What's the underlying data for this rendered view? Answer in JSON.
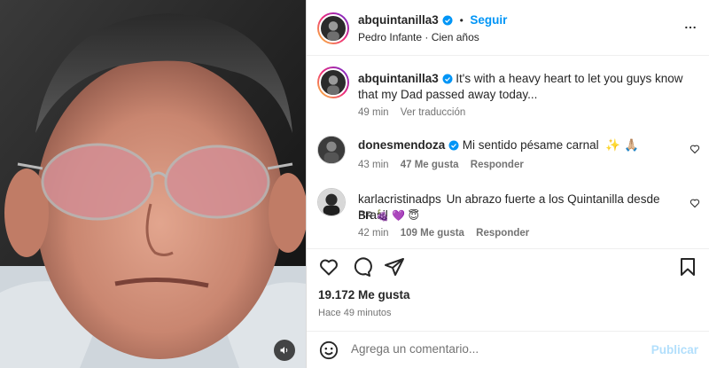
{
  "post": {
    "header": {
      "username": "abquintanilla3",
      "separator": "•",
      "follow_label": "Seguir",
      "location": "Pedro Infante · Cien años"
    },
    "caption": {
      "username": "abquintanilla3",
      "text": "It's with a heavy heart to let you guys know that my Dad passed away today...",
      "time": "49 min",
      "translate_label": "Ver traducción"
    },
    "comments": [
      {
        "username": "donesmendoza",
        "text": "Mi sentido pésame carnal",
        "emoji": "✨ 🙏🏼",
        "time": "43 min",
        "likes": "47 Me gusta",
        "reply_label": "Responder"
      },
      {
        "username": "karlacristinadps",
        "text": "Un abrazo fuerte a los Quintanilla desde Brasil",
        "emoji_line": "BR 🍇 💜 😇",
        "time": "42 min",
        "likes": "109 Me gusta",
        "reply_label": "Responder"
      }
    ],
    "likes_count": "19.172 Me gusta",
    "posted_ago": "Hace 49 minutos",
    "composer": {
      "placeholder": "Agrega un comentario...",
      "publish_label": "Publicar"
    }
  },
  "colors": {
    "accent": "#0095f6",
    "verified": "#0095f6",
    "muted_text": "#737373",
    "publish_disabled": "#b2dffc"
  },
  "icons": {
    "like": "heart-icon",
    "comment": "comment-icon",
    "share": "share-icon",
    "save": "bookmark-icon",
    "emoji": "emoji-icon",
    "mute": "sound-icon",
    "more": "more-options-icon"
  }
}
